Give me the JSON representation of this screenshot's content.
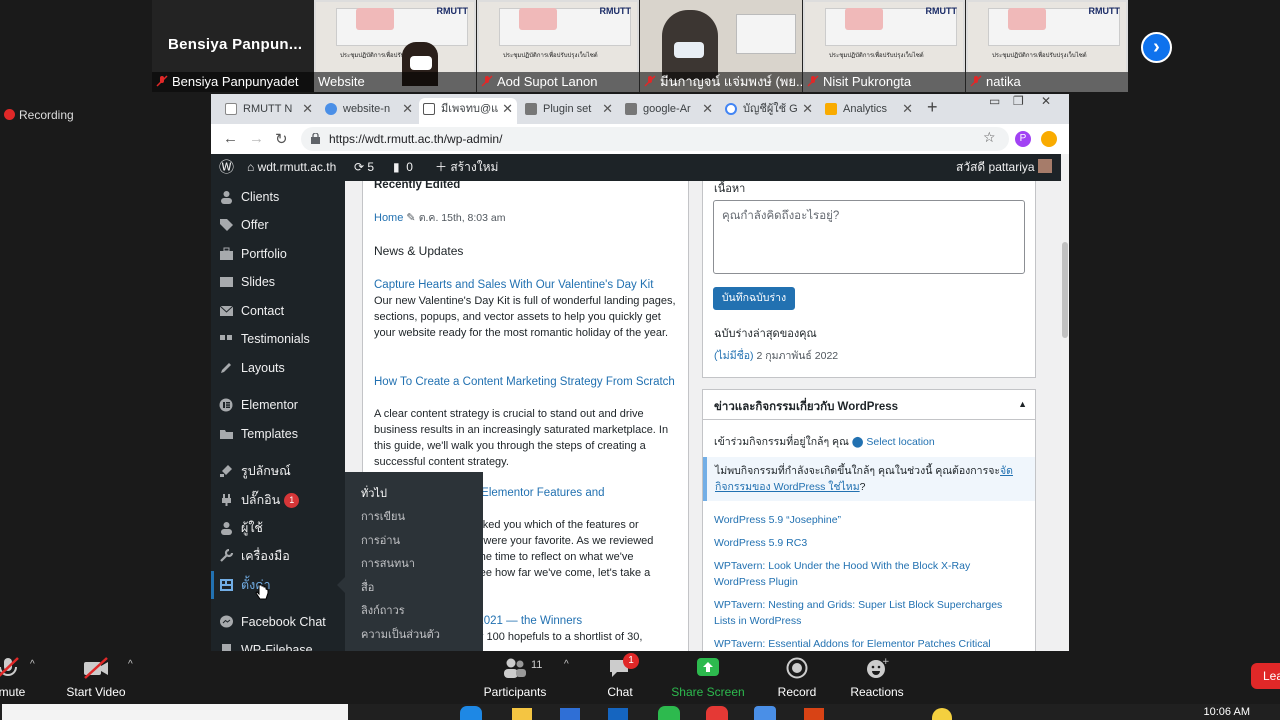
{
  "zoom": {
    "main_speaker": "Bensiya  Panpun...",
    "participants": [
      {
        "name": "Bensiya Panpunyadet",
        "kind": "big"
      },
      {
        "name": "Website",
        "kind": "share"
      },
      {
        "name": "Aod Supot Lanon",
        "kind": "share"
      },
      {
        "name": "มีนกาญจน์ แจ่มพงษ์ (พย...",
        "kind": "person"
      },
      {
        "name": "Nisit Pukrongta",
        "kind": "share"
      },
      {
        "name": "natika",
        "kind": "share"
      }
    ],
    "share_slide_text": "ประชุมปฏิบัติการเพื่อปรับปรุงเว็บไซต์",
    "share_logo": "RMUTT",
    "recording_label": "Recording",
    "controls": {
      "mute": "mute",
      "start_video": "Start Video",
      "participants": "Participants",
      "participants_count": "11",
      "chat": "Chat",
      "chat_badge": "1",
      "share_screen": "Share Screen",
      "record": "Record",
      "reactions": "Reactions",
      "leave": "Lea"
    },
    "colors": {
      "share_green": "#2dba4e",
      "leave_red": "#e02828",
      "accent_blue": "#0e72ed"
    }
  },
  "browser": {
    "tabs": [
      {
        "label": "RMUTT N",
        "icon": "doc-icon",
        "active": false
      },
      {
        "label": "website-n",
        "icon": "cloud-icon",
        "active": false
      },
      {
        "label": "มีเพจทบ@แ",
        "icon": "doc-icon",
        "active": true
      },
      {
        "label": "Plugin set",
        "icon": "plugin-icon",
        "active": false
      },
      {
        "label": "google-Ar",
        "icon": "plugin-icon",
        "active": false
      },
      {
        "label": "บัญชีผู้ใช้ G",
        "icon": "google-icon",
        "active": false
      },
      {
        "label": "Analytics",
        "icon": "analytics-icon",
        "active": false
      }
    ],
    "new_tab": "+",
    "url": "https://wdt.rmutt.ac.th/wp-admin/"
  },
  "wp": {
    "adminbar": {
      "site": "wdt.rmutt.ac.th",
      "updates": "5",
      "comments": "0",
      "new": "สร้างใหม่",
      "greeting": "สวัสดี pattariya"
    },
    "menu": [
      {
        "label": "Clients",
        "icon": "user-icon"
      },
      {
        "label": "Offer",
        "icon": "tag-icon"
      },
      {
        "label": "Portfolio",
        "icon": "portfolio-icon"
      },
      {
        "label": "Slides",
        "icon": "slides-icon"
      },
      {
        "label": "Contact",
        "icon": "mail-icon"
      },
      {
        "label": "Testimonials",
        "icon": "quote-icon"
      },
      {
        "label": "Layouts",
        "icon": "pencil-icon"
      },
      {
        "label": "Elementor",
        "icon": "elementor-icon"
      },
      {
        "label": "Templates",
        "icon": "folder-icon"
      },
      {
        "label": "รูปลักษณ์",
        "icon": "brush-icon"
      },
      {
        "label": "ปลั๊กอิน",
        "icon": "plugin-icon",
        "badge": "1"
      },
      {
        "label": "ผู้ใช้",
        "icon": "user-icon"
      },
      {
        "label": "เครื่องมือ",
        "icon": "wrench-icon"
      },
      {
        "label": "ตั้งค่า",
        "icon": "settings-icon",
        "current": true
      },
      {
        "label": "Facebook Chat",
        "icon": "messenger-icon"
      },
      {
        "label": "WP-Filebase",
        "icon": "file-icon"
      }
    ],
    "submenu": [
      "ทั่วไป",
      "การเขียน",
      "การอ่าน",
      "การสนทนา",
      "สื่อ",
      "ลิงก์ถาวร",
      "ความเป็นส่วนตัว"
    ],
    "elementor_overview": {
      "recently_edited": "Recently Edited",
      "recent_item": "Home",
      "recent_date": "ต.ค. 15th, 8:03 am",
      "news_heading": "News & Updates",
      "articles": [
        {
          "title": "Capture Hearts and Sales With Our Valentine's Day Kit",
          "body": "Our new Valentine's Day Kit is full of wonderful landing pages, sections, popups, and vector assets to help you quickly get your website ready for the most romantic holiday of the year."
        },
        {
          "title": "How To Create a Content Marketing Strategy From Scratch",
          "body": "A clear content strategy is crucial to stand out and drive business results in an increasingly saturated marketplace. In this guide, we'll walk you through the steps of creating a successful content strategy."
        },
        {
          "title": "rite Elementor Features and",
          "body_lines": [
            "e asked you which of the features or",
            "021 were your favorite. As we reviewed",
            "ok the time to reflect on what we've",
            "to see how far we've come, let's take a"
          ]
        },
        {
          "title": "se 2021 — the Winners",
          "body_lines": [
            "over 100 hopefuls to a shortlist of 30,"
          ]
        }
      ]
    },
    "quick_draft": {
      "content_label": "เนื้อหา",
      "placeholder": "คุณกำลังคิดถึงอะไรอยู่?",
      "save_button": "บันทึกฉบับร่าง",
      "recent_drafts": "ฉบับร่างล่าสุดของคุณ",
      "draft_link": "(ไม่มีชื่อ)",
      "draft_date": "2 กุมภาพันธ์ 2022"
    },
    "events": {
      "title": "ข่าวและกิจกรรมเกี่ยวกับ WordPress",
      "nearby": "เข้าร่วมกิจกรรมที่อยู่ใกล้ๆ คุณ",
      "select_location": "Select location",
      "notice": "ไม่พบกิจกรรมที่กำลังจะเกิดขึ้นใกล้ๆ คุณในช่วงนี้ คุณต้องการจะ",
      "notice_link": "จัดกิจกรรมของ WordPress ใช่ไหม",
      "notice_end": "?",
      "news": [
        "WordPress 5.9 “Josephine”",
        "WordPress 5.9 RC3",
        "WPTavern: Look Under the Hood With the Block X-Ray WordPress Plugin",
        "WPTavern: Nesting and Grids: Super List Block Supercharges Lists in WordPress",
        "WPTavern: Essential Addons for Elementor Patches Critical"
      ]
    }
  },
  "taskbar": {
    "time": "10:06 AM"
  }
}
